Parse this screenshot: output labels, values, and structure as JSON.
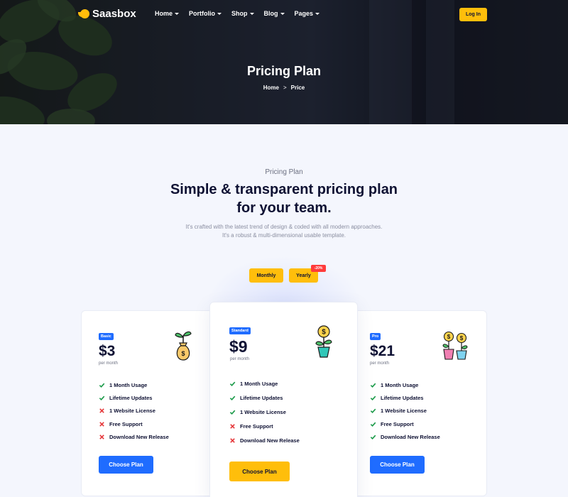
{
  "brand": {
    "name": "Saasbox"
  },
  "nav": {
    "items": [
      {
        "label": "Home"
      },
      {
        "label": "Portfolio"
      },
      {
        "label": "Shop"
      },
      {
        "label": "Blog"
      },
      {
        "label": "Pages"
      }
    ],
    "login_label": "Log In"
  },
  "hero": {
    "title": "Pricing Plan",
    "breadcrumb": {
      "home": "Home",
      "separator": ">",
      "current": "Price"
    }
  },
  "section": {
    "eyebrow": "Pricing Plan",
    "heading_line1": "Simple & transparent pricing plan",
    "heading_line2": "for your team.",
    "desc_line1": "It's crafted with the latest trend of design & coded with all modern approaches.",
    "desc_line2": "It's a robust & multi-dimensional usable template."
  },
  "billing": {
    "monthly_label": "Monthly",
    "yearly_label": "Yearly",
    "discount_badge": "-20%"
  },
  "plans": [
    {
      "badge": "Basic",
      "price": "$3",
      "period": "per month",
      "illustration": "plant-moneybag-icon",
      "features": [
        {
          "text": "1 Month Usage",
          "included": true
        },
        {
          "text": "Lifetime Updates",
          "included": true
        },
        {
          "text": "1 Website License",
          "included": false
        },
        {
          "text": "Free Support",
          "included": false
        },
        {
          "text": "Download New Release",
          "included": false
        }
      ],
      "cta": "Choose Plan"
    },
    {
      "badge": "Standard",
      "price": "$9",
      "period": "per month",
      "illustration": "money-plant-icon",
      "features": [
        {
          "text": "1 Month Usage",
          "included": true
        },
        {
          "text": "Lifetime Updates",
          "included": true
        },
        {
          "text": "1 Website License",
          "included": true
        },
        {
          "text": "Free Support",
          "included": false
        },
        {
          "text": "Download New Release",
          "included": false
        }
      ],
      "cta": "Choose Plan"
    },
    {
      "badge": "Pro",
      "price": "$21",
      "period": "per month",
      "illustration": "double-money-plant-icon",
      "features": [
        {
          "text": "1 Month Usage",
          "included": true
        },
        {
          "text": "Lifetime Updates",
          "included": true
        },
        {
          "text": "1 Website License",
          "included": true
        },
        {
          "text": "Free Support",
          "included": true
        },
        {
          "text": "Download New Release",
          "included": true
        }
      ],
      "cta": "Choose Plan"
    }
  ],
  "colors": {
    "accent_yellow": "#ffbe0b",
    "accent_blue": "#1f6cff",
    "check_green": "#1c9b4a",
    "cross_red": "#e5383b",
    "heading_navy": "#0e1133"
  }
}
